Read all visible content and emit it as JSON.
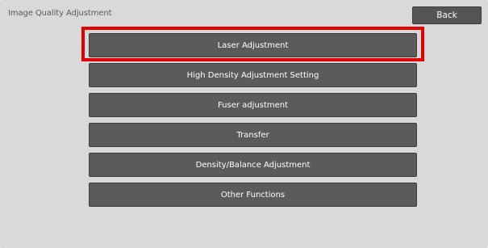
{
  "header": {
    "title": "Image Quality Adjustment",
    "back_label": "Back"
  },
  "menu": {
    "items": [
      {
        "label": "Laser Adjustment",
        "highlighted": true
      },
      {
        "label": "High Density Adjustment Setting"
      },
      {
        "label": "Fuser adjustment"
      },
      {
        "label": "Transfer"
      },
      {
        "label": "Density/Balance Adjustment"
      },
      {
        "label": "Other Functions"
      }
    ]
  },
  "colors": {
    "background": "#d9d9d9",
    "button": "#5b5b5b",
    "button_text": "#ffffff",
    "highlight": "#e30000"
  }
}
